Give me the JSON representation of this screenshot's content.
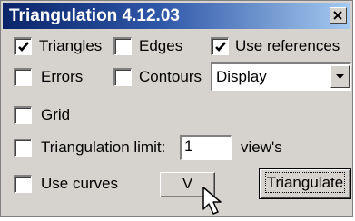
{
  "window": {
    "title": "Triangulation 4.12.03",
    "close_label": "×"
  },
  "options": {
    "triangles": {
      "label": "Triangles",
      "checked": true
    },
    "edges": {
      "label": "Edges",
      "checked": false
    },
    "use_references": {
      "label": "Use references",
      "checked": true
    },
    "errors": {
      "label": "Errors",
      "checked": false
    },
    "contours": {
      "label": "Contours",
      "checked": false
    },
    "grid": {
      "label": "Grid",
      "checked": false
    },
    "triangulation_limit": {
      "label": "Triangulation limit:",
      "checked": false,
      "value": "1",
      "unit": "view's"
    },
    "use_curves": {
      "label": "Use curves",
      "checked": false
    }
  },
  "display_select": {
    "value": "Display"
  },
  "buttons": {
    "v_label": "V",
    "triangulate_label": "Triangulate"
  },
  "colors": {
    "titlebar_start": "#0a246a",
    "titlebar_end": "#a6caf0",
    "face": "#d6d3ce"
  }
}
